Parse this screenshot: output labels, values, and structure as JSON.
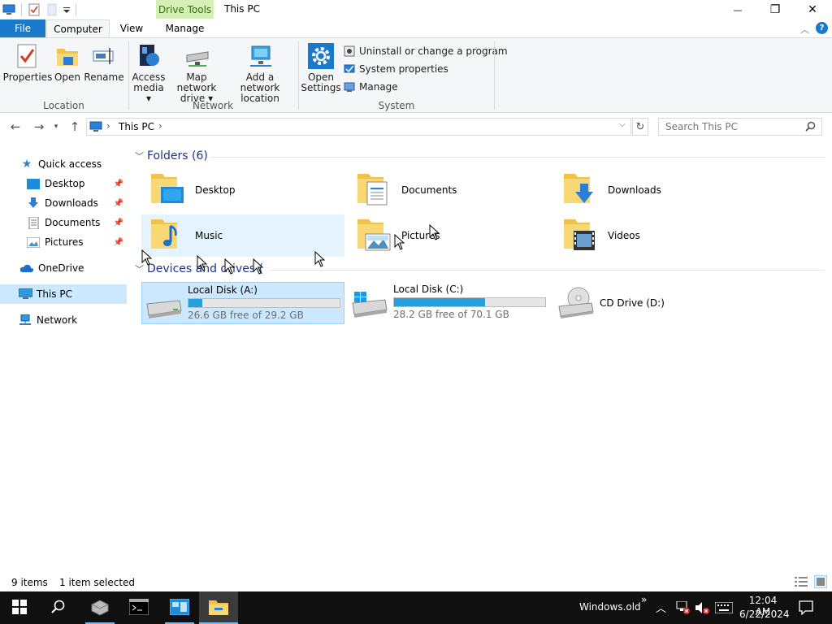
{
  "window": {
    "title": "This PC",
    "context_tab": "Drive Tools",
    "minimize_glyph": "—",
    "maximize_glyph": "❐",
    "close_glyph": "✕"
  },
  "ribbon_tabs": {
    "file": "File",
    "computer": "Computer",
    "view": "View",
    "manage": "Manage"
  },
  "ribbon": {
    "location": {
      "label": "Location",
      "properties": "Properties",
      "open": "Open",
      "rename": "Rename"
    },
    "network": {
      "label": "Network",
      "access_media_line1": "Access",
      "access_media_line2": "media ▾",
      "map_drive_line1": "Map network",
      "map_drive_line2": "drive ▾",
      "add_location_line1": "Add a network",
      "add_location_line2": "location"
    },
    "system": {
      "label": "System",
      "open_settings_line1": "Open",
      "open_settings_line2": "Settings",
      "uninstall": "Uninstall or change a program",
      "system_properties": "System properties",
      "manage": "Manage"
    }
  },
  "address": {
    "path_root": "This PC",
    "separator": "›",
    "search_placeholder": "Search This PC"
  },
  "nav_pane": {
    "quick_access": "Quick access",
    "desktop": "Desktop",
    "downloads": "Downloads",
    "documents": "Documents",
    "pictures": "Pictures",
    "onedrive": "OneDrive",
    "this_pc": "This PC",
    "network": "Network"
  },
  "folders": {
    "header": "Folders (6)",
    "items": [
      "Desktop",
      "Documents",
      "Downloads",
      "Music",
      "Pictures",
      "Videos"
    ]
  },
  "devices": {
    "header": "Devices and drives (",
    "drives": [
      {
        "name": "Local Disk (A:)",
        "free": "26.6 GB free of 29.2 GB",
        "used_fraction": 0.09
      },
      {
        "name": "Local Disk (C:)",
        "free": "28.2 GB free of 70.1 GB",
        "used_fraction": 0.6
      },
      {
        "name": "CD Drive (D:)"
      }
    ]
  },
  "status": {
    "item_count": "9 items",
    "selected": "1 item selected"
  },
  "taskbar": {
    "windows_old": "Windows.old",
    "chevron": "»",
    "time": "12:04 AM",
    "date": "6/22/2024"
  },
  "colors": {
    "accent": "#1979ca",
    "selection": "#cce8ff",
    "hover": "#e5f3ff",
    "drive_bar": "#26a0da",
    "context_tab": "#d4f0b4"
  }
}
